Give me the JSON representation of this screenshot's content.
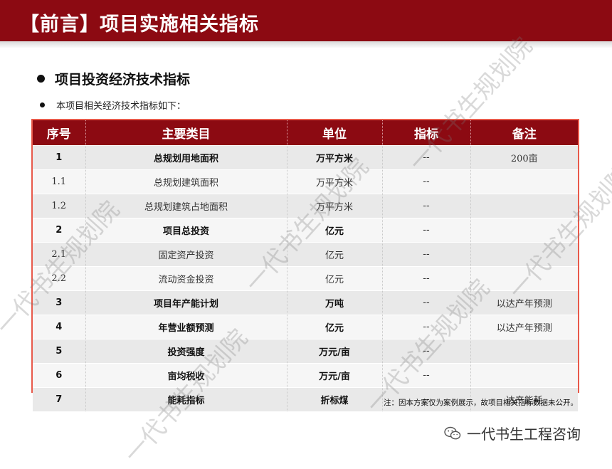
{
  "header": {
    "title": "【前言】项目实施相关指标"
  },
  "section": {
    "heading": "项目投资经济技术指标",
    "intro": "本项目相关经济技术指标如下："
  },
  "table": {
    "columns": [
      "序号",
      "主要类目",
      "单位",
      "指标",
      "备注"
    ],
    "rows": [
      {
        "no": "1",
        "item": "总规划用地面积",
        "unit": "万平方米",
        "value": "--",
        "note": "200亩",
        "bold": true
      },
      {
        "no": "1.1",
        "item": "总规划建筑面积",
        "unit": "万平方米",
        "value": "--",
        "note": "",
        "bold": false
      },
      {
        "no": "1.2",
        "item": "总规划建筑占地面积",
        "unit": "万平方米",
        "value": "--",
        "note": "",
        "bold": false
      },
      {
        "no": "2",
        "item": "项目总投资",
        "unit": "亿元",
        "value": "--",
        "note": "",
        "bold": true
      },
      {
        "no": "2.1",
        "item": "固定资产投资",
        "unit": "亿元",
        "value": "--",
        "note": "",
        "bold": false
      },
      {
        "no": "2.2",
        "item": "流动资金投资",
        "unit": "亿元",
        "value": "--",
        "note": "",
        "bold": false
      },
      {
        "no": "3",
        "item": "项目年产能计划",
        "unit": "万吨",
        "value": "--",
        "note": "以达产年预测",
        "bold": true
      },
      {
        "no": "4",
        "item": "年营业额预测",
        "unit": "亿元",
        "value": "--",
        "note": "以达产年预测",
        "bold": true
      },
      {
        "no": "5",
        "item": "投资强度",
        "unit": "万元/亩",
        "value": "--",
        "note": "",
        "bold": true
      },
      {
        "no": "6",
        "item": "亩均税收",
        "unit": "万元/亩",
        "value": "--",
        "note": "",
        "bold": true
      },
      {
        "no": "7",
        "item": "能耗指标",
        "unit": "折标煤",
        "value": "--",
        "note": "达产能耗",
        "bold": true
      }
    ]
  },
  "footer": {
    "note": "注：因本方案仅为案例展示，故项目相关指标数据未公开。",
    "brand": "一代书生工程咨询",
    "brand_icon": "wechat-icon"
  },
  "watermark": {
    "text": "一代书生规划院"
  },
  "colors": {
    "header_bg": "#8c0a12",
    "table_border": "#e8594a"
  }
}
